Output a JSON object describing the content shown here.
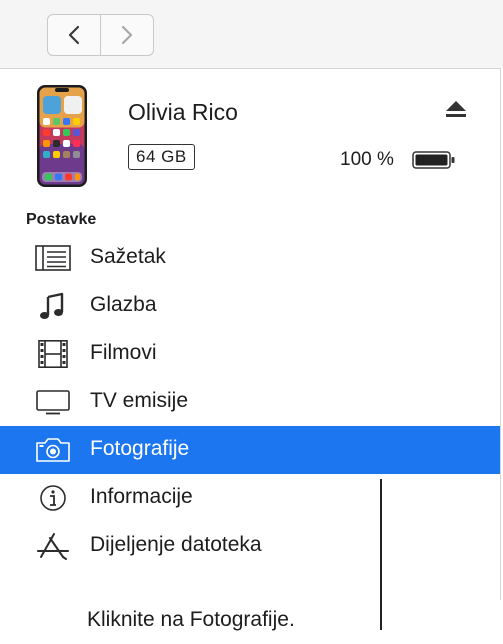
{
  "toolbar": {
    "back_icon": "chevron-left-icon",
    "forward_icon": "chevron-right-icon"
  },
  "device": {
    "name": "Olivia Rico",
    "capacity": "64 GB",
    "battery": "100 %",
    "eject_icon": "eject-icon",
    "battery_icon": "battery-full-icon"
  },
  "settings": {
    "title": "Postavke",
    "items": [
      {
        "label": "Sažetak",
        "icon": "list-icon",
        "selected": false
      },
      {
        "label": "Glazba",
        "icon": "music-note-icon",
        "selected": false
      },
      {
        "label": "Filmovi",
        "icon": "film-icon",
        "selected": false
      },
      {
        "label": "TV emisije",
        "icon": "tv-icon",
        "selected": false
      },
      {
        "label": "Fotografije",
        "icon": "camera-icon",
        "selected": true
      },
      {
        "label": "Informacije",
        "icon": "info-icon",
        "selected": false
      },
      {
        "label": "Dijeljenje datoteka",
        "icon": "app-store-icon",
        "selected": false
      }
    ]
  },
  "callout": {
    "text": "Kliknite na Fotografije."
  },
  "colors": {
    "accent": "#1b76f0",
    "battery": "#222222"
  }
}
